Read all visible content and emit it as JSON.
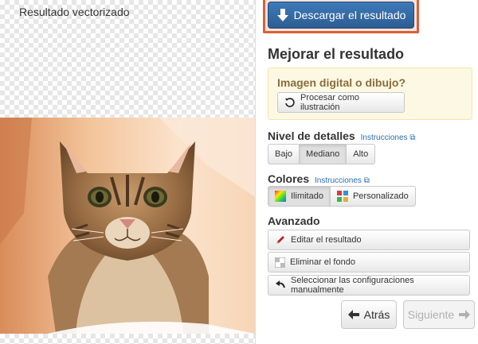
{
  "preview": {
    "title": "Resultado vectorizado"
  },
  "panel": {
    "download_label": "Descargar el resultado",
    "improve_title": "Mejorar el resultado",
    "alert": {
      "question": "Imagen digital o dibujo?",
      "process_button": "Procesar como ilustración"
    },
    "details": {
      "label": "Nivel de detalles",
      "link": "Instrucciones",
      "options": [
        "Bajo",
        "Mediano",
        "Alto"
      ],
      "selected": "Mediano"
    },
    "colors": {
      "label": "Colores",
      "link": "Instrucciones",
      "options": [
        "Ilimitado",
        "Personalizado"
      ],
      "selected": "Ilimitado"
    },
    "advanced": {
      "label": "Avanzado",
      "actions": [
        {
          "label": "Editar el resultado",
          "icon": "pencil-icon"
        },
        {
          "label": "Eliminar el fondo",
          "icon": "background-icon"
        },
        {
          "label": "Seleccionar las configuraciones manualmente",
          "icon": "undo-icon"
        }
      ]
    },
    "nav": {
      "back": "Atrás",
      "next": "Siguiente"
    }
  },
  "colors": {
    "accent": "#2d5d92",
    "highlight_border": "#d9603a",
    "alert_bg": "#fcf8e3",
    "link": "#2a6db5"
  }
}
